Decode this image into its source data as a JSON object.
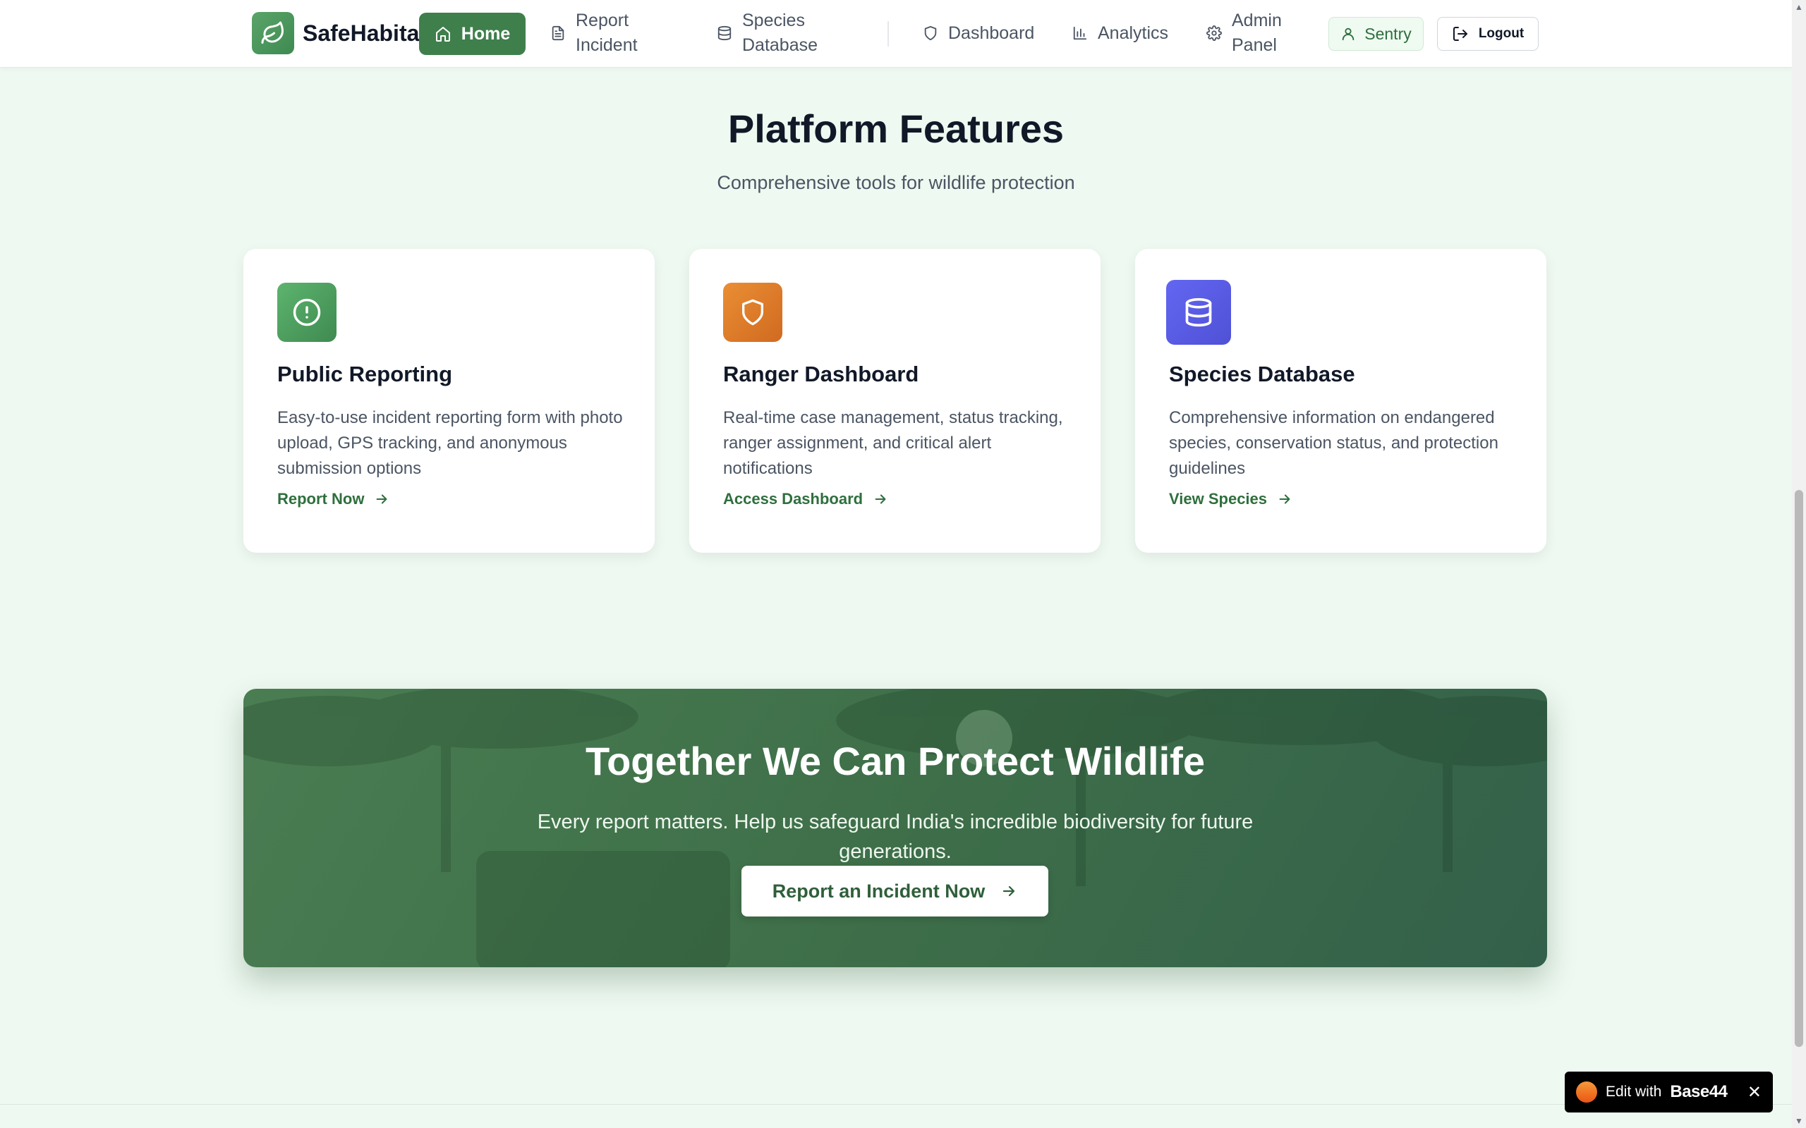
{
  "navbar": {
    "brand": "SafeHabitat",
    "items": [
      {
        "label": "Home"
      },
      {
        "label": "Report\nIncident"
      },
      {
        "label": "Species\nDatabase"
      },
      {
        "label": "Dashboard"
      },
      {
        "label": "Analytics"
      },
      {
        "label": "Admin\nPanel"
      }
    ],
    "user_label": "Sentry",
    "logout_label": "Logout"
  },
  "features": {
    "title": "Platform Features",
    "subtitle": "Comprehensive tools for wildlife protection",
    "cards": [
      {
        "icon": "alert-circle-icon",
        "color": "#5aa46a",
        "title": "Public Reporting",
        "description": "Easy-to-use incident reporting form with photo upload, GPS tracking, and anonymous submission options",
        "link": "Report Now"
      },
      {
        "icon": "shield-icon",
        "color": "#e07e2a",
        "title": "Ranger Dashboard",
        "description": "Real-time case management, status tracking, ranger assignment, and critical alert notifications",
        "link": "Access Dashboard"
      },
      {
        "icon": "database-icon",
        "color": "#5a5fe0",
        "title": "Species Database",
        "description": "Comprehensive information on endangered species, conservation status, and protection guidelines",
        "link": "View Species"
      }
    ]
  },
  "cta": {
    "title": "Together We Can Protect Wildlife",
    "text": "Every report matters. Help us safeguard India's incredible biodiversity for future generations.",
    "button": "Report an Incident Now"
  },
  "badge": {
    "prefix": "Edit with",
    "brand": "Base44",
    "close": "✕"
  },
  "colors": {
    "accent": "#3f7f4c",
    "background": "#eef9f1"
  }
}
